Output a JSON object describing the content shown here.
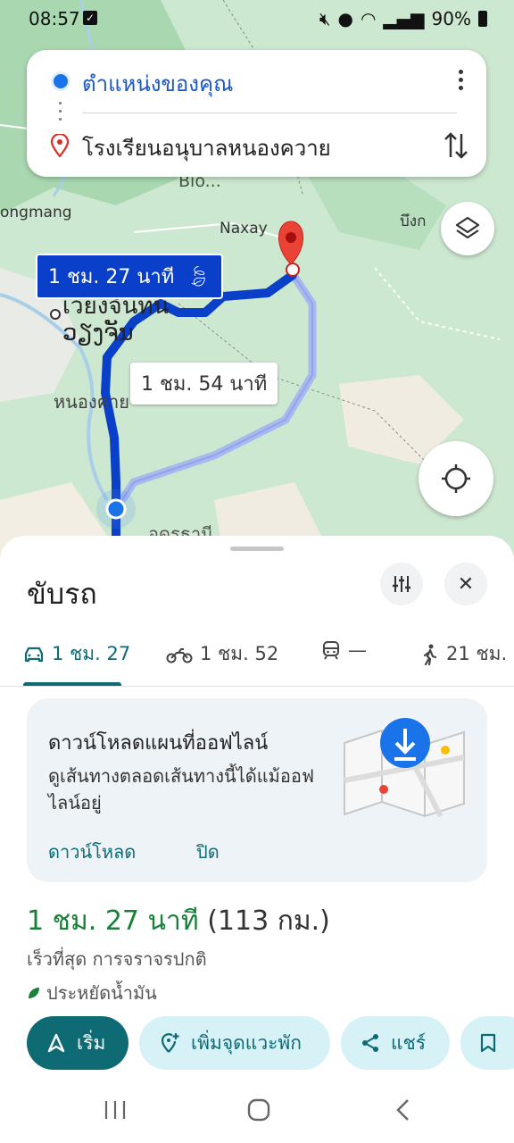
{
  "status_bar": {
    "time": "08:57",
    "battery": "90%"
  },
  "search": {
    "origin": "ตำแหน่งของคุณ",
    "destination": "โรงเรียนอนุบาลหนองควาย"
  },
  "map": {
    "route_main_label": "1 ชม. 27 นาที",
    "route_alt_label": "1 ชม. 54 นาที",
    "labels": {
      "naxay": "Naxay",
      "vientiane_th": "เวียงจันทน์",
      "vientiane_lo": "ວຽງຈັນ",
      "nongkhai": "หนองคาย",
      "udon": "อุดรธานี",
      "bio": "Bio...",
      "ongmang": "ongmang",
      "bueng": "บึงก"
    }
  },
  "sheet": {
    "title": "ขับรถ",
    "modes": [
      {
        "icon": "car-icon",
        "label": "1 ชม. 27"
      },
      {
        "icon": "motorbike-icon",
        "label": "1 ชม. 52"
      },
      {
        "icon": "transit-icon",
        "label": "—"
      },
      {
        "icon": "walk-icon",
        "label": "21 ชม."
      }
    ],
    "offline_card": {
      "title": "ดาวน์โหลดแผนที่ออฟไลน์",
      "body": "ดูเส้นทางตลอดเส้นทางนี้ได้แม้ออฟไลน์อยู่",
      "download": "ดาวน์โหลด",
      "close": "ปิด"
    },
    "summary": {
      "duration": "1 ชม. 27 นาที",
      "distance": " (113 กม.)",
      "detail": "เร็วที่สุด การจราจรปกติ",
      "eco": "ประหยัดน้ำมัน"
    },
    "actions": {
      "start": "เริ่ม",
      "add_stop": "เพิ่มจุดแวะพัก",
      "share": "แชร์"
    }
  },
  "colors": {
    "route_main": "#0a3fc9",
    "route_alt": "#a9b9f0",
    "accent_teal": "#0e6a73",
    "duration_green": "#188038"
  }
}
